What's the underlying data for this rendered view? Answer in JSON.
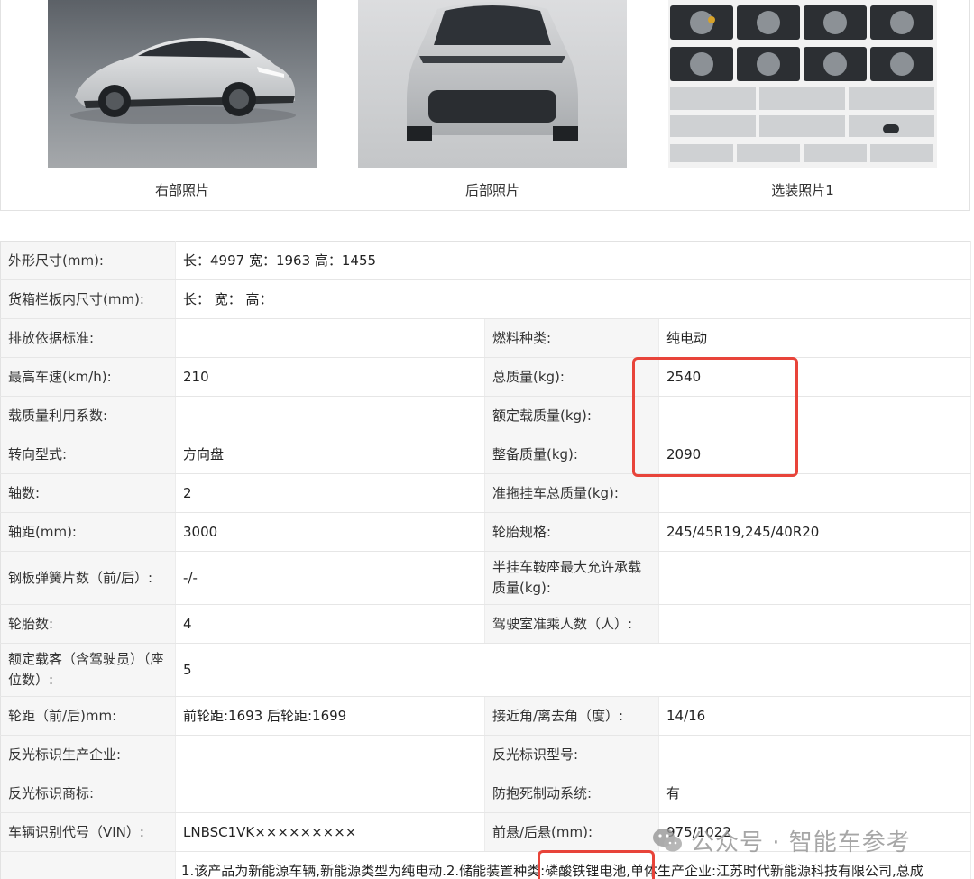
{
  "photos": [
    {
      "caption": "右部照片",
      "icon": "car-side-photo"
    },
    {
      "caption": "后部照片",
      "icon": "car-rear-photo"
    },
    {
      "caption": "选装照片1",
      "icon": "optional-parts-photo"
    }
  ],
  "params": {
    "rows": [
      {
        "l1": "外形尺寸(mm):",
        "v1": "长：4997 宽：1963 高：1455"
      },
      {
        "l1": "货箱栏板内尺寸(mm):",
        "v1": "长： 宽： 高："
      },
      {
        "l1": "排放依据标准:",
        "v1": "",
        "l2": "燃料种类:",
        "v2": "纯电动"
      },
      {
        "l1": "最高车速(km/h):",
        "v1": "210",
        "l2": "总质量(kg):",
        "v2": "2540"
      },
      {
        "l1": "载质量利用系数:",
        "v1": "",
        "l2": "额定载质量(kg):",
        "v2": ""
      },
      {
        "l1": "转向型式:",
        "v1": "方向盘",
        "l2": "整备质量(kg):",
        "v2": "2090"
      },
      {
        "l1": "轴数:",
        "v1": "2",
        "l2": "准拖挂车总质量(kg):",
        "v2": ""
      },
      {
        "l1": "轴距(mm):",
        "v1": "3000",
        "l2": "轮胎规格:",
        "v2": "245/45R19,245/40R20"
      },
      {
        "l1": "钢板弹簧片数（前/后）:",
        "v1": "-/-",
        "l2": "半挂车鞍座最大允许承载质量(kg):",
        "v2": ""
      },
      {
        "l1": "轮胎数:",
        "v1": "4",
        "l2": "驾驶室准乘人数（人）:",
        "v2": ""
      },
      {
        "l1": "额定载客（含驾驶员）（座位数）:",
        "v1": "5"
      },
      {
        "l1": "轮距（前/后)mm:",
        "v1": "前轮距:1693 后轮距:1699",
        "l2": "接近角/离去角（度）:",
        "v2": "14/16"
      },
      {
        "l1": "反光标识生产企业:",
        "v1": "",
        "l2": "反光标识型号:",
        "v2": ""
      },
      {
        "l1": "反光标识商标:",
        "v1": "",
        "l2": "防抱死制动系统:",
        "v2": "有"
      },
      {
        "l1": "车辆识别代号（VIN）:",
        "v1": "LNBSC1VK×××××××××",
        "l2": "前悬/后悬(mm):",
        "v2": "975/1022"
      }
    ],
    "note": "1.该产品为新能源车辆,新能源类型为纯电动.2.储能装置种类:磷酸铁锂电池,单体生产企业:江苏时代新能源科技有限公司,总成"
  },
  "watermark": {
    "text": "公众号 · 智能车参考",
    "icon": "wechat-icon"
  },
  "colors": {
    "highlight": "#e8443a",
    "label_bg": "#f6f6f6",
    "border": "#e2e2e2"
  }
}
